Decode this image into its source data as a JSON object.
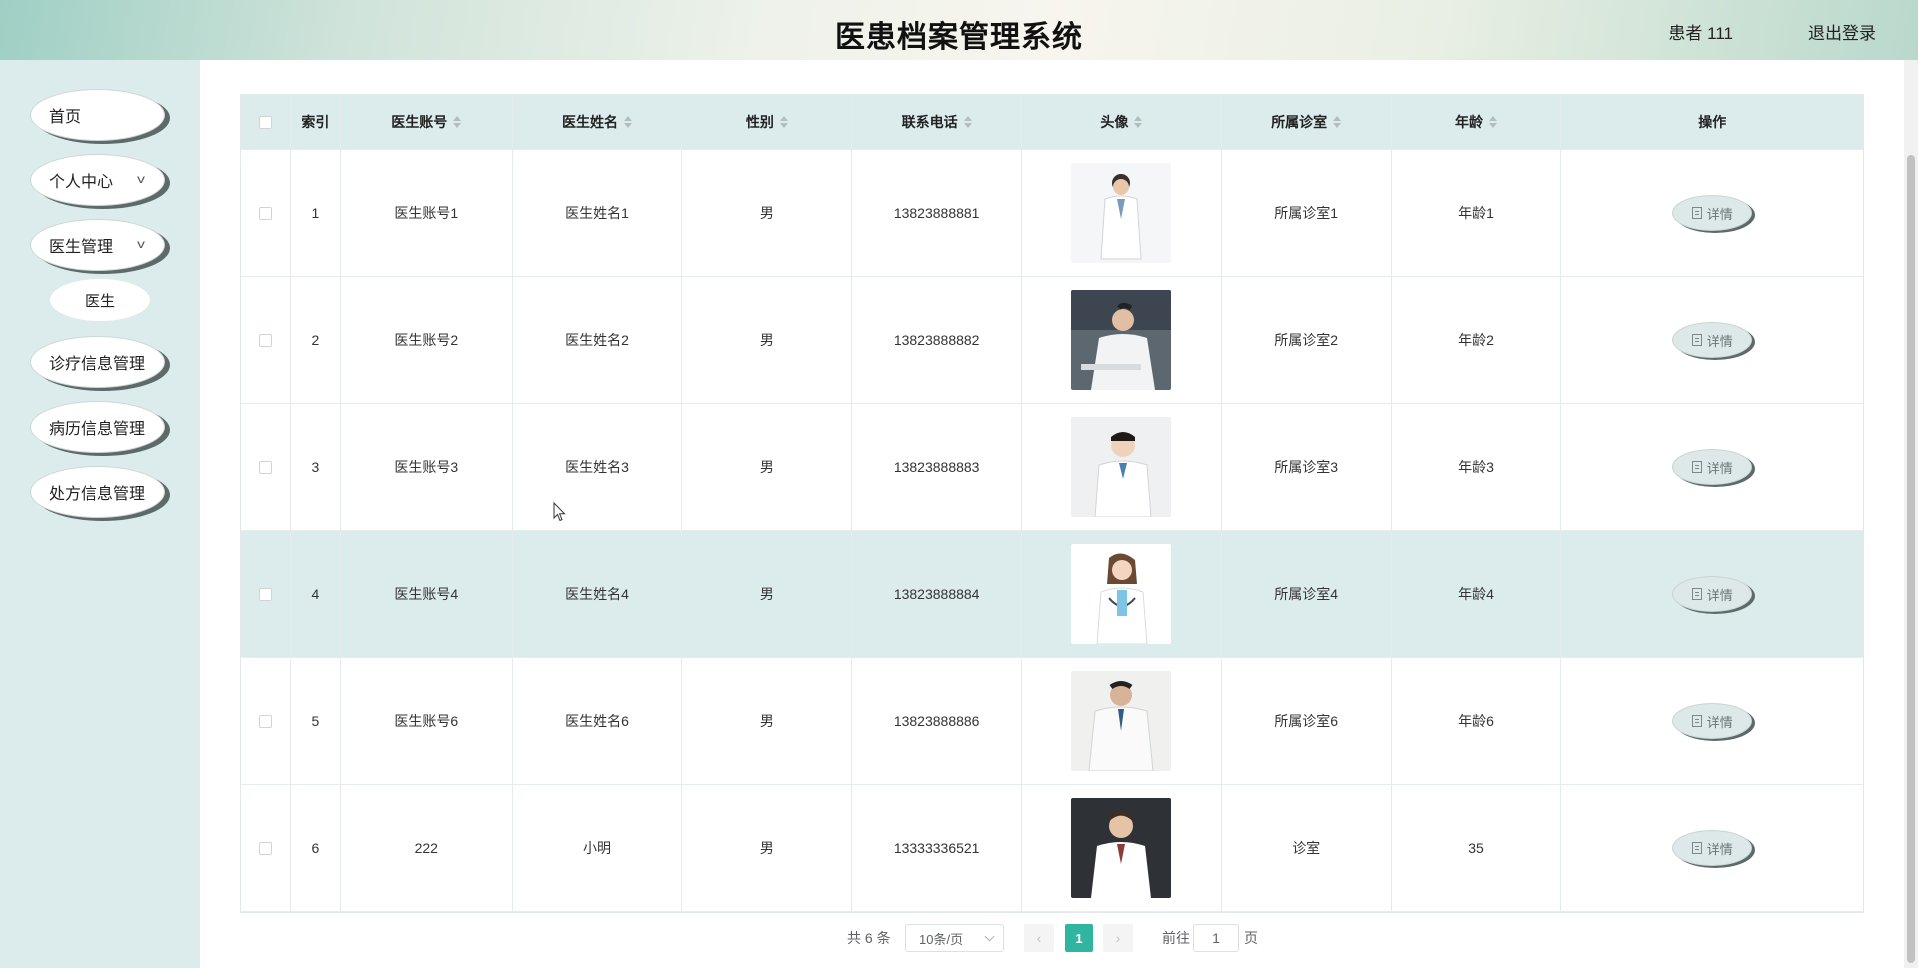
{
  "header": {
    "title": "医患档案管理系统",
    "user": "患者 111",
    "logout": "退出登录"
  },
  "sidebar": {
    "items": [
      {
        "label": "首页",
        "has_chevron": false
      },
      {
        "label": "个人中心",
        "has_chevron": true
      },
      {
        "label": "医生管理",
        "has_chevron": true
      },
      {
        "label": "诊疗信息管理",
        "has_chevron": false
      },
      {
        "label": "病历信息管理",
        "has_chevron": false
      },
      {
        "label": "处方信息管理",
        "has_chevron": false
      }
    ],
    "sub_item": "医生"
  },
  "table": {
    "columns": [
      "索引",
      "医生账号",
      "医生姓名",
      "性别",
      "联系电话",
      "头像",
      "所属诊室",
      "年龄",
      "操作"
    ],
    "detail_label": "详情",
    "rows": [
      {
        "index": "1",
        "account": "医生账号1",
        "name": "医生姓名1",
        "sex": "男",
        "phone": "13823888881",
        "room": "所属诊室1",
        "age": "年龄1"
      },
      {
        "index": "2",
        "account": "医生账号2",
        "name": "医生姓名2",
        "sex": "男",
        "phone": "13823888882",
        "room": "所属诊室2",
        "age": "年龄2"
      },
      {
        "index": "3",
        "account": "医生账号3",
        "name": "医生姓名3",
        "sex": "男",
        "phone": "13823888883",
        "room": "所属诊室3",
        "age": "年龄3"
      },
      {
        "index": "4",
        "account": "医生账号4",
        "name": "医生姓名4",
        "sex": "男",
        "phone": "13823888884",
        "room": "所属诊室4",
        "age": "年龄4"
      },
      {
        "index": "5",
        "account": "医生账号6",
        "name": "医生姓名6",
        "sex": "男",
        "phone": "13823888886",
        "room": "所属诊室6",
        "age": "年龄6"
      },
      {
        "index": "6",
        "account": "222",
        "name": "小明",
        "sex": "男",
        "phone": "13333336521",
        "room": "诊室",
        "age": "35"
      }
    ]
  },
  "pagination": {
    "total": "共 6 条",
    "page_size": "10条/页",
    "current": "1",
    "goto_label": "前往",
    "goto_value": "1",
    "page_suffix": "页"
  },
  "colors": {
    "accent": "#2fb5a0",
    "sidebar_bg": "#dcecec",
    "header_row_bg": "#dcecec"
  }
}
